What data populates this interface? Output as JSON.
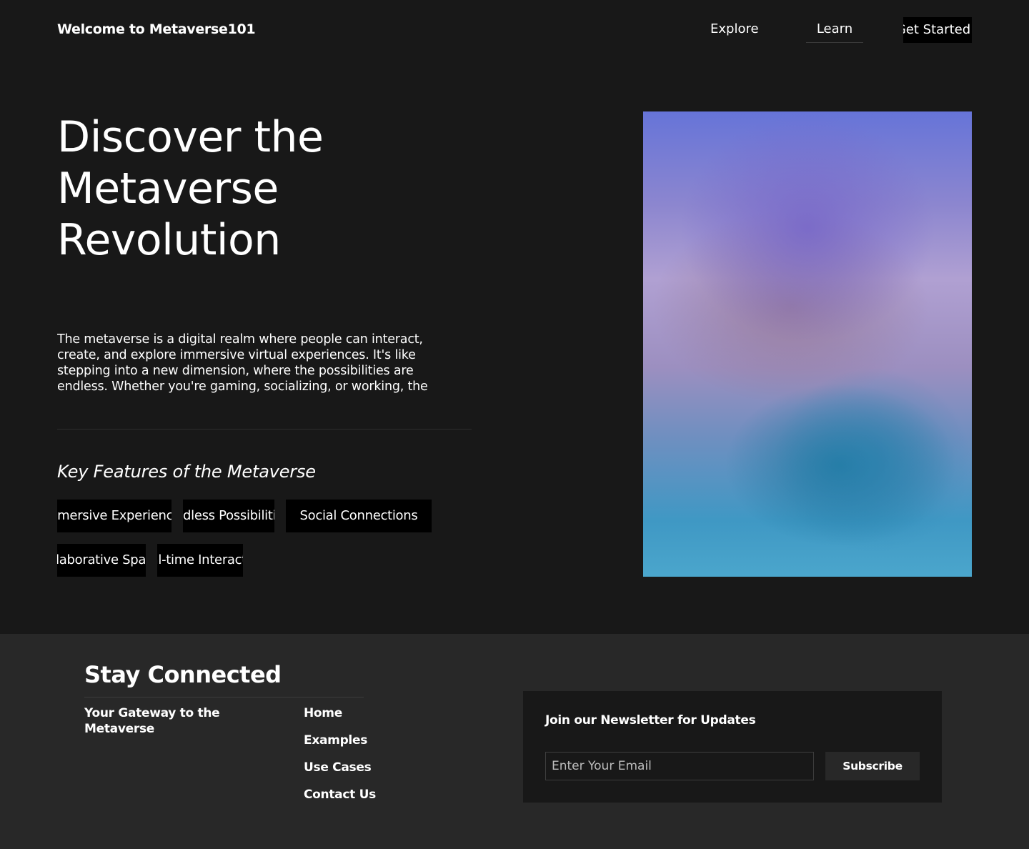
{
  "header": {
    "brand": "Welcome to Metaverse101",
    "nav": {
      "explore": "Explore",
      "learn": "Learn",
      "get_started": "Get Started"
    }
  },
  "hero": {
    "title_lines": [
      "Discover the",
      "Metaverse",
      "Revolution"
    ],
    "description": "The metaverse is a digital realm where people can interact, create, and explore immersive virtual experiences. It's like stepping into a new dimension, where the possibilities are endless. Whether you're gaming, socializing, or working, the",
    "features_title": "Key Features of the Metaverse",
    "features": [
      "Immersive Experiences",
      "Endless Possibilities",
      "Social Connections",
      "Collaborative Spaces",
      "Real-time Interaction"
    ]
  },
  "footer": {
    "title": "Stay Connected",
    "tagline": "Your Gateway to the Metaverse",
    "links": [
      "Home",
      "Examples",
      "Use Cases",
      "Contact Us"
    ],
    "newsletter": {
      "title": "Join our Newsletter for Updates",
      "email_placeholder": "Enter Your Email",
      "subscribe_label": "Subscribe"
    }
  },
  "colors": {
    "background": "#181818",
    "footer_background": "#282828",
    "tag_background": "#000000",
    "text": "#ffffff"
  }
}
